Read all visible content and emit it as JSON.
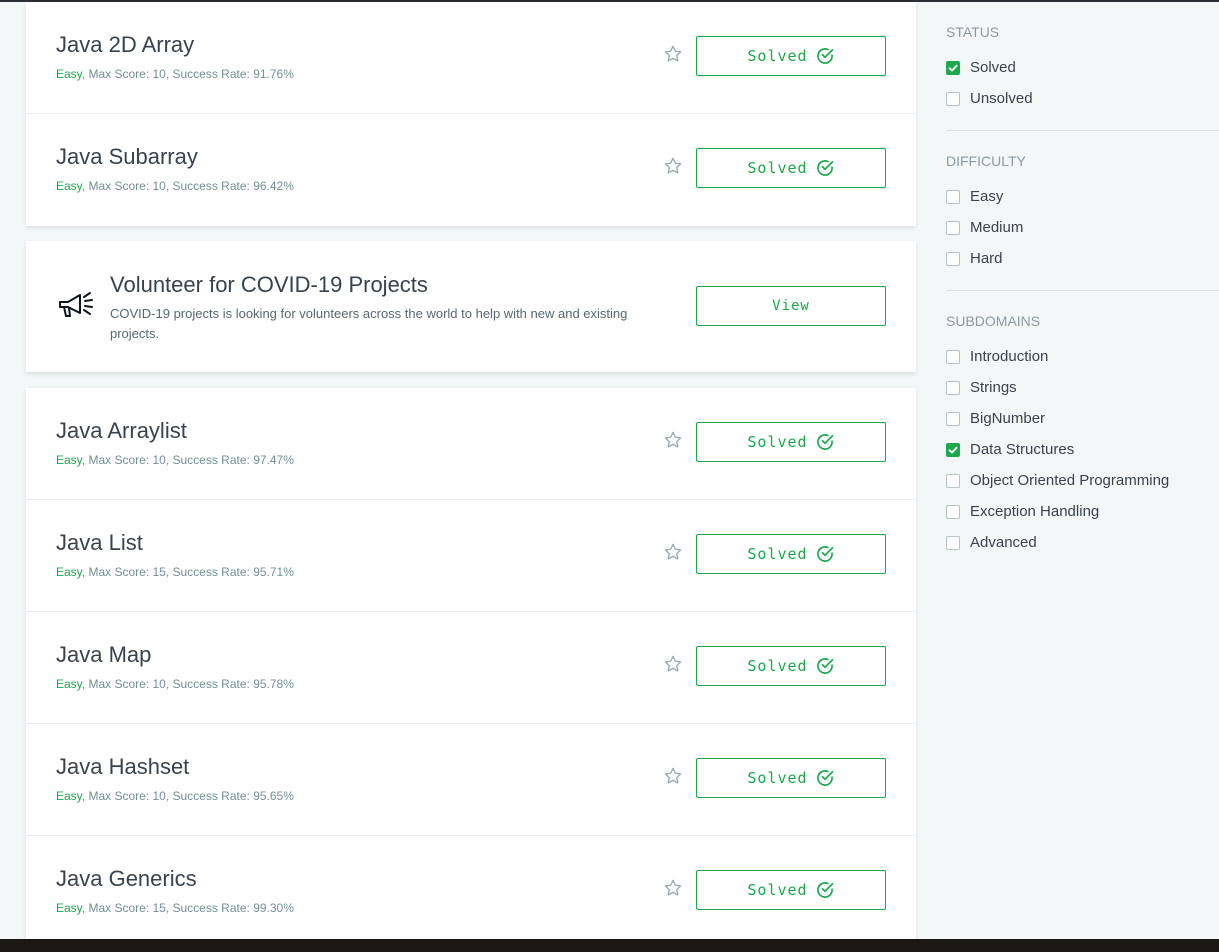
{
  "colors": {
    "accent": "#1ba94c",
    "page_bg": "#f3f7f7",
    "text": "#39424e",
    "meta": "#738f93"
  },
  "challenges_top": [
    {
      "title": "Java 2D Array",
      "difficulty": "Easy",
      "meta": ", Max Score: 10, Success Rate: 91.76%",
      "button": "Solved"
    },
    {
      "title": "Java Subarray",
      "difficulty": "Easy",
      "meta": ", Max Score: 10, Success Rate: 96.42%",
      "button": "Solved"
    }
  ],
  "promo": {
    "icon": "megaphone-icon",
    "title": "Volunteer for COVID-19 Projects",
    "description": "COVID-19 projects is looking for volunteers across the world to help with new and existing projects.",
    "button": "View"
  },
  "challenges_bottom": [
    {
      "title": "Java Arraylist",
      "difficulty": "Easy",
      "meta": ", Max Score: 10, Success Rate: 97.47%",
      "button": "Solved"
    },
    {
      "title": "Java List",
      "difficulty": "Easy",
      "meta": ", Max Score: 15, Success Rate: 95.71%",
      "button": "Solved"
    },
    {
      "title": "Java Map",
      "difficulty": "Easy",
      "meta": ", Max Score: 10, Success Rate: 95.78%",
      "button": "Solved"
    },
    {
      "title": "Java Hashset",
      "difficulty": "Easy",
      "meta": ", Max Score: 10, Success Rate: 95.65%",
      "button": "Solved"
    },
    {
      "title": "Java Generics",
      "difficulty": "Easy",
      "meta": ", Max Score: 15, Success Rate: 99.30%",
      "button": "Solved"
    }
  ],
  "filters": {
    "status": {
      "heading": "STATUS",
      "items": [
        {
          "label": "Solved",
          "checked": true
        },
        {
          "label": "Unsolved",
          "checked": false
        }
      ]
    },
    "difficulty": {
      "heading": "DIFFICULTY",
      "items": [
        {
          "label": "Easy",
          "checked": false
        },
        {
          "label": "Medium",
          "checked": false
        },
        {
          "label": "Hard",
          "checked": false
        }
      ]
    },
    "subdomains": {
      "heading": "SUBDOMAINS",
      "items": [
        {
          "label": "Introduction",
          "checked": false
        },
        {
          "label": "Strings",
          "checked": false
        },
        {
          "label": "BigNumber",
          "checked": false
        },
        {
          "label": "Data Structures",
          "checked": true
        },
        {
          "label": "Object Oriented Programming",
          "checked": false
        },
        {
          "label": "Exception Handling",
          "checked": false
        },
        {
          "label": "Advanced",
          "checked": false
        }
      ]
    }
  }
}
